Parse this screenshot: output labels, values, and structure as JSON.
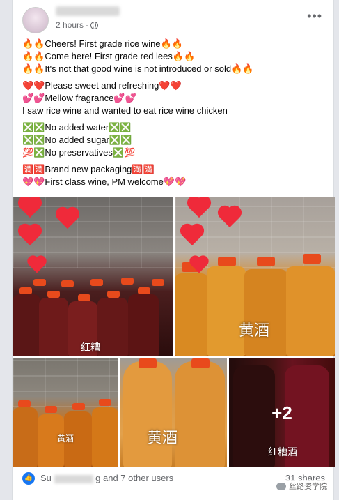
{
  "post": {
    "timestamp": "2 hours",
    "separator": "·",
    "menu_glyph": "•••",
    "lines_a": [
      "🔥🔥Cheers! First grade rice wine🔥🔥",
      "🔥🔥Come here! First grade red lees🔥🔥",
      "🔥🔥It's not that good wine is not introduced or sold🔥🔥"
    ],
    "lines_b": [
      "❤️❤️Please sweet and refreshing❤️❤️",
      "💕💕Mellow fragrance💕💕",
      "I saw rice wine and wanted to eat rice wine chicken"
    ],
    "lines_c": [
      "❎❎No added water❎❎",
      "❎❎No added sugar❎❎",
      "💯❎No preservatives❎💯"
    ],
    "lines_d": [
      "🈵🈵Brand new packaging🈵🈵",
      "💖💖First class wine, PM welcome💖💖"
    ]
  },
  "photos": {
    "wm_red_lees": "红糟",
    "wm_yellow": "黄酒",
    "wm_yellow_small": "黄酒",
    "wm_yellow_big": "黄酒",
    "wm_red_lees_wine": "红糟酒",
    "more_count": "+2"
  },
  "footer": {
    "reactors_prefix": "Su",
    "reactors_suffix": "g and 7 other users",
    "shares": "31 shares",
    "watermark": "丝路资学院"
  },
  "colors": {
    "brand": "#1877f2",
    "heart": "#ef2a3a",
    "cap": "#e84a1c"
  }
}
